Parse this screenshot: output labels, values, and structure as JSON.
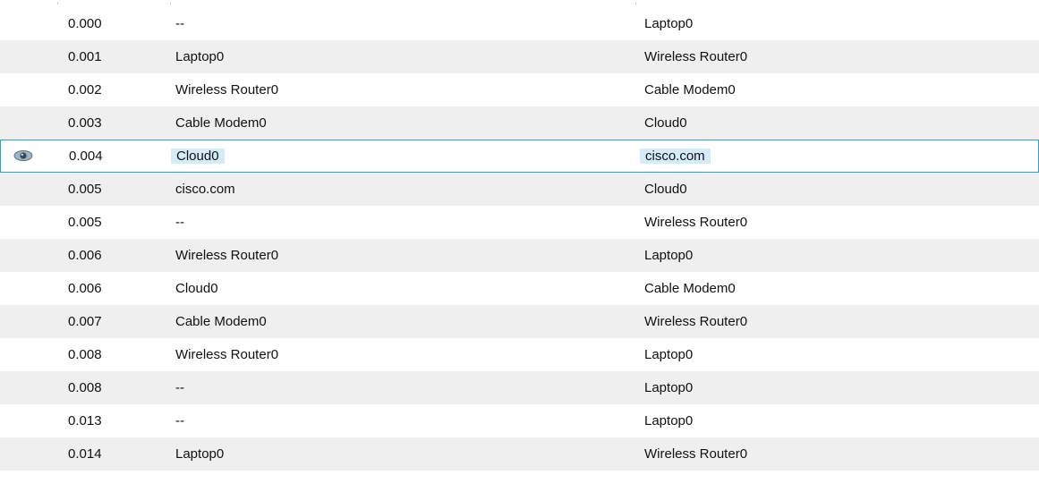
{
  "events": {
    "columns": [],
    "rows": [
      {
        "time": "0.000",
        "last_device": "--",
        "at_device": "Laptop0"
      },
      {
        "time": "0.001",
        "last_device": "Laptop0",
        "at_device": "Wireless Router0"
      },
      {
        "time": "0.002",
        "last_device": "Wireless Router0",
        "at_device": "Cable Modem0"
      },
      {
        "time": "0.003",
        "last_device": "Cable Modem0",
        "at_device": "Cloud0"
      },
      {
        "time": "0.004",
        "last_device": "Cloud0",
        "at_device": "cisco.com",
        "selected": true,
        "icon": "eye-icon"
      },
      {
        "time": "0.005",
        "last_device": "cisco.com",
        "at_device": "Cloud0"
      },
      {
        "time": "0.005",
        "last_device": "--",
        "at_device": "Wireless Router0"
      },
      {
        "time": "0.006",
        "last_device": "Wireless Router0",
        "at_device": "Laptop0"
      },
      {
        "time": "0.006",
        "last_device": "Cloud0",
        "at_device": "Cable Modem0"
      },
      {
        "time": "0.007",
        "last_device": "Cable Modem0",
        "at_device": "Wireless Router0"
      },
      {
        "time": "0.008",
        "last_device": "Wireless Router0",
        "at_device": "Laptop0"
      },
      {
        "time": "0.008",
        "last_device": "--",
        "at_device": "Laptop0"
      },
      {
        "time": "0.013",
        "last_device": "--",
        "at_device": "Laptop0"
      },
      {
        "time": "0.014",
        "last_device": "Laptop0",
        "at_device": "Wireless Router0"
      }
    ]
  },
  "colors": {
    "selection_border": "#29a3d6",
    "selection_highlight": "#d4ebf8",
    "alt_row": "#efefef"
  }
}
